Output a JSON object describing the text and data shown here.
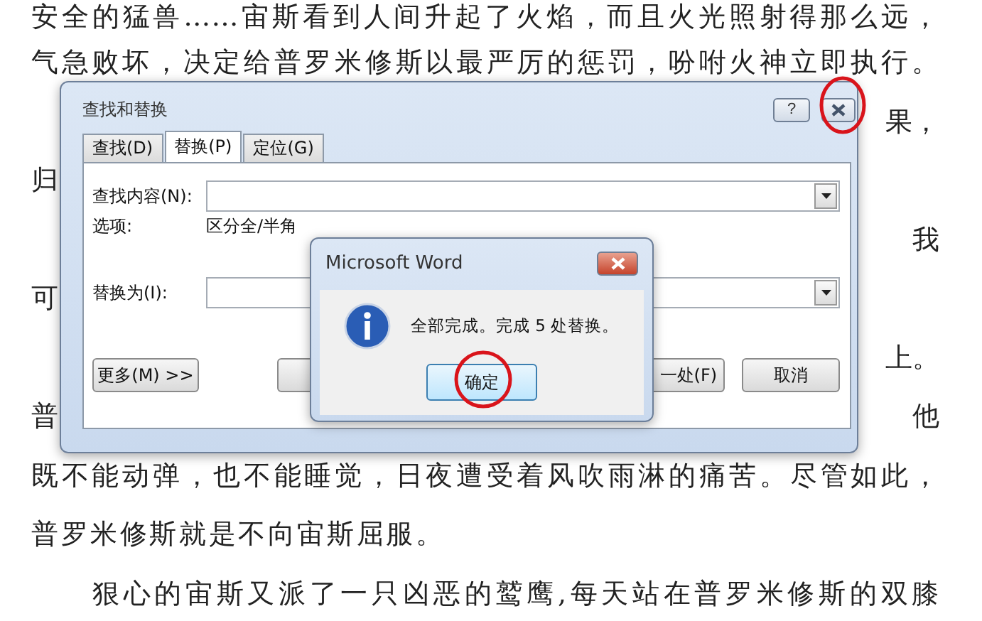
{
  "document": {
    "lines": [
      {
        "kind": "full",
        "text": "安全的猛兽……宙斯看到人间升起了火焰，而且火光照射得那么远，"
      },
      {
        "kind": "full",
        "text": "气急败坏，决定给普罗米修斯以最严厉的惩罚，吩咐火神立即执行。"
      },
      {
        "kind": "split",
        "right": "果，"
      },
      {
        "kind": "split",
        "left": "归"
      },
      {
        "kind": "split",
        "right": "我"
      },
      {
        "kind": "split",
        "left": "可"
      },
      {
        "kind": "split",
        "right": "上。"
      },
      {
        "kind": "split",
        "left": "普",
        "right": "他"
      },
      {
        "kind": "full",
        "text": "既不能动弹，也不能睡觉，日夜遭受着风吹雨淋的痛苦。尽管如此，"
      },
      {
        "kind": "plain",
        "text": "普罗米修斯就是不向宙斯屈服。"
      },
      {
        "kind": "indented",
        "text": "狠心的宙斯又派了一只凶恶的鹫鹰,每天站在普罗米修斯的双膝"
      }
    ]
  },
  "find_replace_dialog": {
    "title": "查找和替换",
    "help_button": "?",
    "tabs": [
      {
        "label": "查找(D)",
        "selected": false
      },
      {
        "label": "替换(P)",
        "selected": true
      },
      {
        "label": "定位(G)",
        "selected": false
      }
    ],
    "find_field": {
      "label": "查找内容(N):"
    },
    "options": {
      "label": "选项:",
      "value": "区分全/半角"
    },
    "replace_field": {
      "label": "替换为(I):"
    },
    "more_button": "更多(M) >>",
    "find_next_button": "一处(F)",
    "cancel_button": "取消"
  },
  "message_box": {
    "title": "Microsoft Word",
    "message": "全部完成。完成 5 处替换。",
    "ok_button": "确定"
  }
}
